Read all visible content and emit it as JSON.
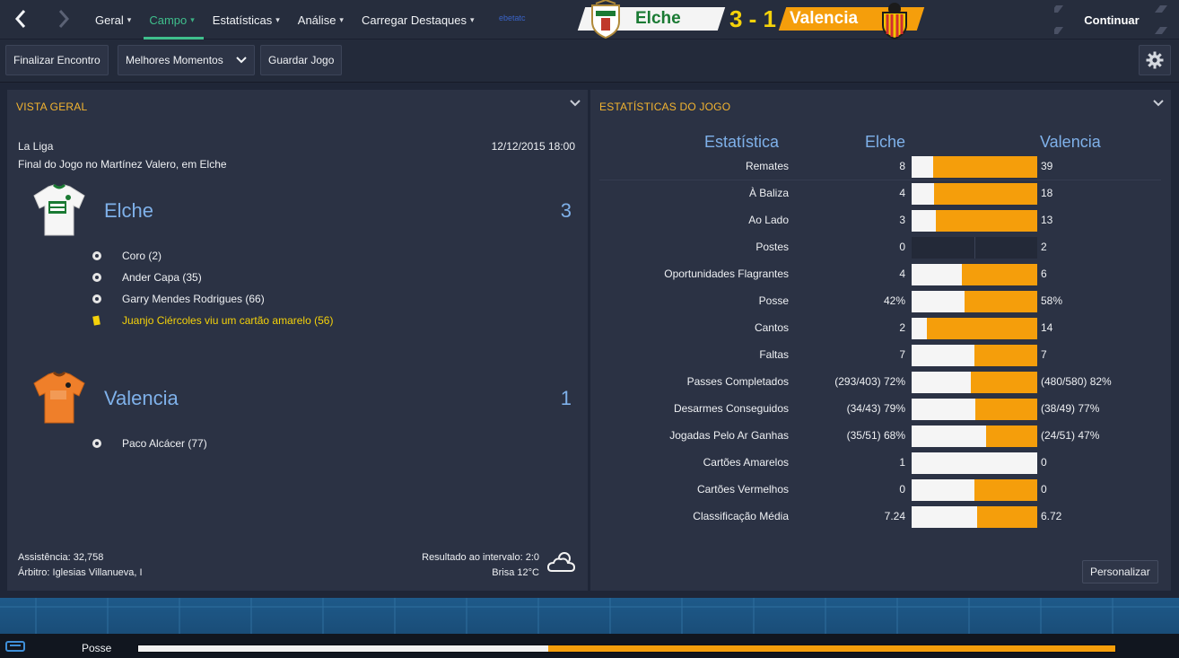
{
  "nav": {
    "menu": [
      {
        "label": "Geral",
        "active": false
      },
      {
        "label": "Campo",
        "active": true
      },
      {
        "label": "Estatísticas",
        "active": false
      },
      {
        "label": "Análise",
        "active": false
      },
      {
        "label": "Carregar Destaques",
        "active": false
      }
    ],
    "brand_text": "ebetatc"
  },
  "scoreboard": {
    "home": "Elche",
    "away": "Valencia",
    "score": "3 - 1",
    "continue_label": "Continuar"
  },
  "toolbar": {
    "finish_label": "Finalizar Encontro",
    "highlights_label": "Melhores Momentos",
    "save_label": "Guardar Jogo"
  },
  "overview": {
    "title": "VISTA GERAL",
    "competition": "La Liga",
    "datetime": "12/12/2015 18:00",
    "venue_text": "Final do Jogo no Martínez Valero, em Elche",
    "home": {
      "name": "Elche",
      "score": "3",
      "events": [
        {
          "text": "Coro (2)",
          "type": "goal"
        },
        {
          "text": "Ander Capa (35)",
          "type": "goal"
        },
        {
          "text": "Garry Mendes Rodrigues (66)",
          "type": "goal"
        },
        {
          "text": "Juanjo Ciércoles viu um cartão amarelo (56)",
          "type": "yellow"
        }
      ]
    },
    "away": {
      "name": "Valencia",
      "score": "1",
      "events": [
        {
          "text": "Paco Alcácer (77)",
          "type": "goal"
        }
      ]
    },
    "attendance": "Assistência: 32,758",
    "referee": "Árbitro: Iglesias Villanueva, I",
    "halftime": "Resultado ao intervalo: 2:0",
    "weather": "Brisa 12°C"
  },
  "stats": {
    "title": "ESTATÍSTICAS DO JOGO",
    "header_stat": "Estatística",
    "header_home": "Elche",
    "header_away": "Valencia",
    "customize_label": "Personalizar",
    "rows": [
      {
        "label": "Remates",
        "home": "8",
        "away": "39",
        "home_share": 0.17
      },
      {
        "label": "À Baliza",
        "home": "4",
        "away": "18",
        "home_share": 0.18
      },
      {
        "label": "Ao Lado",
        "home": "3",
        "away": "13",
        "home_share": 0.19
      },
      {
        "label": "Postes",
        "home": "0",
        "away": "2",
        "home_share": 0.0,
        "empty": true
      },
      {
        "label": "Oportunidades Flagrantes",
        "home": "4",
        "away": "6",
        "home_share": 0.4
      },
      {
        "label": "Posse",
        "home": "42%",
        "away": "58%",
        "home_share": 0.42
      },
      {
        "label": "Cantos",
        "home": "2",
        "away": "14",
        "home_share": 0.12
      },
      {
        "label": "Faltas",
        "home": "7",
        "away": "7",
        "home_share": 0.5
      },
      {
        "label": "Passes Completados",
        "home": "(293/403) 72%",
        "away": "(480/580) 82%",
        "home_share": 0.47
      },
      {
        "label": "Desarmes Conseguidos",
        "home": "(34/43) 79%",
        "away": "(38/49) 77%",
        "home_share": 0.51
      },
      {
        "label": "Jogadas Pelo Ar Ganhas",
        "home": "(35/51) 68%",
        "away": "(24/51) 47%",
        "home_share": 0.59
      },
      {
        "label": "Cartões Amarelos",
        "home": "1",
        "away": "0",
        "home_share": 1.0
      },
      {
        "label": "Cartões Vermelhos",
        "home": "0",
        "away": "0",
        "home_share": 0.5
      },
      {
        "label": "Classificação Média",
        "home": "7.24",
        "away": "6.72",
        "home_share": 0.52
      }
    ]
  },
  "bottom": {
    "possession_label": "Posse",
    "home_possession": 0.42
  },
  "colors": {
    "accent_green": "#3fbf8c",
    "orange": "#f59e0b",
    "title_gold": "#f3b430",
    "team_blue": "#7fb1ea",
    "yellow_card": "#f5d20a"
  }
}
